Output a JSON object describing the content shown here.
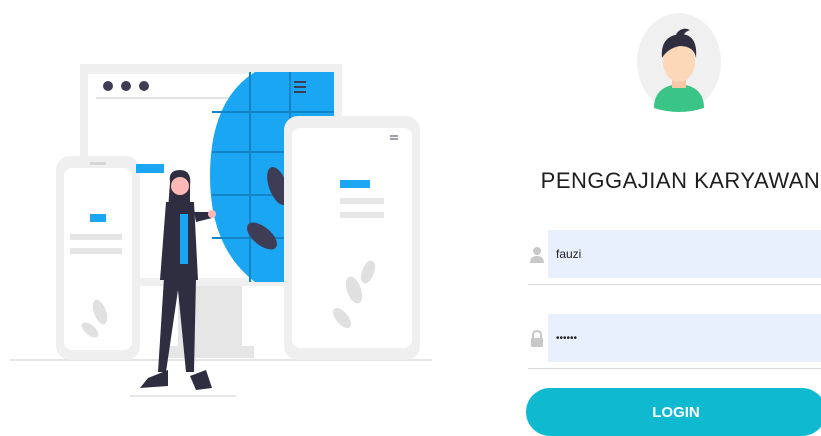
{
  "app": {
    "title": "PENGGAJIAN KARYAWAN"
  },
  "login_form": {
    "username": {
      "value": "fauzi",
      "icon": "user-icon"
    },
    "password": {
      "value": "••••••",
      "icon": "lock-icon"
    },
    "login_label": "LOGIN"
  },
  "colors": {
    "accent": "#0fbad1",
    "input_bg": "#e8f0fe",
    "illustration_blue": "#1aa6f2",
    "avatar_bg": "#f0f0f0",
    "avatar_shirt": "#3ac586"
  }
}
